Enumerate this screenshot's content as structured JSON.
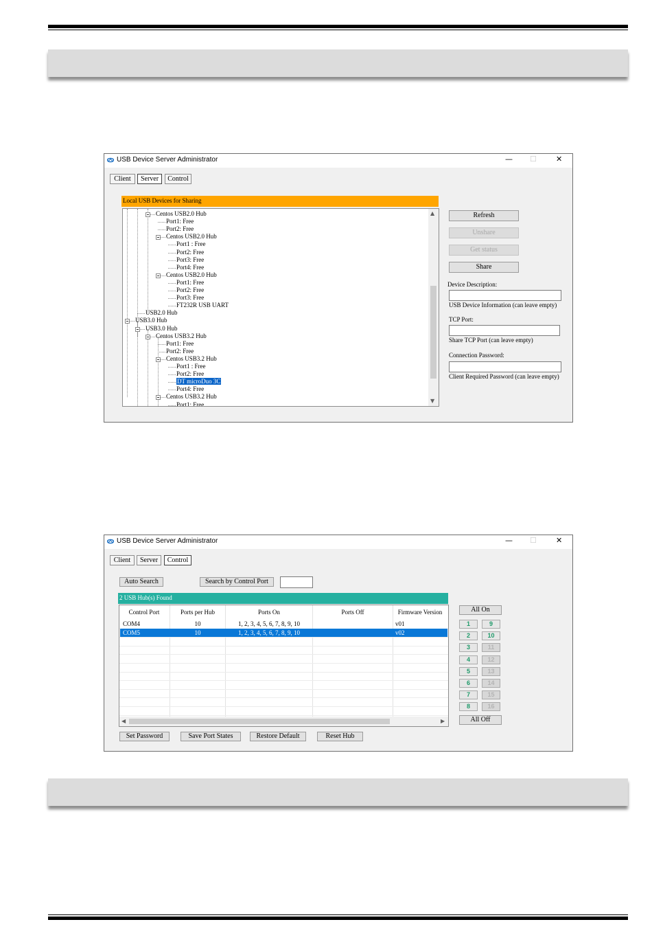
{
  "window1": {
    "title": "USB Device Server Administrator",
    "controls": {
      "minimize": "—",
      "maximize": "☐",
      "close": "✕"
    },
    "tabs": [
      "Client",
      "Server",
      "Control"
    ],
    "active_tab": "Server",
    "panel_header": "Local USB Devices for Sharing",
    "tree": [
      {
        "text": "Centos USB2.0 Hub",
        "level": 3,
        "expander": true
      },
      {
        "text": "Port1: Free",
        "level": 4
      },
      {
        "text": "Port2: Free",
        "level": 4
      },
      {
        "text": "Centos USB2.0 Hub",
        "level": 4,
        "expander": true
      },
      {
        "text": "Port1 : Free",
        "level": 5
      },
      {
        "text": "Port2: Free",
        "level": 5
      },
      {
        "text": "Port3: Free",
        "level": 5
      },
      {
        "text": "Port4: Free",
        "level": 5
      },
      {
        "text": "Centos USB2.0 Hub",
        "level": 4,
        "expander": true
      },
      {
        "text": "Port1: Free",
        "level": 5
      },
      {
        "text": "Port2: Free",
        "level": 5
      },
      {
        "text": "Port3: Free",
        "level": 5
      },
      {
        "text": "FT232R USB UART",
        "level": 5
      },
      {
        "text": "USB2.0 Hub",
        "level": 2
      },
      {
        "text": "USB3.0 Hub",
        "level": 1,
        "expander": true
      },
      {
        "text": "USB3.0 Hub",
        "level": 2,
        "expander": true
      },
      {
        "text": "Centos USB3.2 Hub",
        "level": 3,
        "expander": true
      },
      {
        "text": "Port1: Free",
        "level": 4
      },
      {
        "text": "Port2: Free",
        "level": 4
      },
      {
        "text": "Centos USB3.2 Hub",
        "level": 4,
        "expander": true
      },
      {
        "text": "Port1 : Free",
        "level": 5
      },
      {
        "text": "Port2: Free",
        "level": 5
      },
      {
        "text": "DT microDuo 3C",
        "level": 5,
        "selected": true
      },
      {
        "text": "Port4: Free",
        "level": 5
      },
      {
        "text": "Centos USB3.2 Hub",
        "level": 4,
        "expander": true
      },
      {
        "text": "Port1: Free",
        "level": 5
      }
    ],
    "buttons": {
      "refresh": "Refresh",
      "unshare": "Unshare",
      "get_status": "Get status",
      "share": "Share"
    },
    "device_description": {
      "label": "Device Description:",
      "value": "",
      "hint": "USB Device Information (can leave empty)"
    },
    "tcp_port": {
      "label": "TCP Port:",
      "value": "",
      "hint": "Share TCP Port (can leave empty)"
    },
    "connection_password": {
      "label": "Connection Password:",
      "value": "",
      "hint": "Client Required Password (can leave empty)"
    }
  },
  "window2": {
    "title": "USB Device Server Administrator",
    "controls": {
      "minimize": "—",
      "maximize": "☐",
      "close": "✕"
    },
    "tabs": [
      "Client",
      "Server",
      "Control"
    ],
    "active_tab": "Control",
    "auto_search": "Auto Search",
    "search_by_port": "Search by Control Port",
    "control_port_value": "",
    "found_header": "2 USB Hub(s) Found",
    "columns": [
      "Control Port",
      "Ports per Hub",
      "Ports On",
      "Ports Off",
      "Firmware Version"
    ],
    "rows": [
      {
        "port": "COM4",
        "ports_per_hub": "10",
        "ports_on": "1, 2, 3, 4, 5, 6, 7, 8, 9, 10",
        "ports_off": "",
        "firmware": "v01",
        "selected": false
      },
      {
        "port": "COM5",
        "ports_per_hub": "10",
        "ports_on": "1, 2, 3, 4, 5, 6, 7, 8, 9, 10",
        "ports_off": "",
        "firmware": "v02",
        "selected": true
      }
    ],
    "all_on": "All On",
    "all_off": "All Off",
    "port_buttons": [
      {
        "label": "1",
        "enabled": true
      },
      {
        "label": "9",
        "enabled": true
      },
      {
        "label": "2",
        "enabled": true
      },
      {
        "label": "10",
        "enabled": true
      },
      {
        "label": "3",
        "enabled": true
      },
      {
        "label": "11",
        "enabled": false
      },
      {
        "label": "4",
        "enabled": true
      },
      {
        "label": "12",
        "enabled": false
      },
      {
        "label": "5",
        "enabled": true
      },
      {
        "label": "13",
        "enabled": false
      },
      {
        "label": "6",
        "enabled": true
      },
      {
        "label": "14",
        "enabled": false
      },
      {
        "label": "7",
        "enabled": true
      },
      {
        "label": "15",
        "enabled": false
      },
      {
        "label": "8",
        "enabled": true
      },
      {
        "label": "16",
        "enabled": false
      }
    ],
    "bottom_buttons": [
      "Set Password",
      "Save Port States",
      "Restore Default",
      "Reset Hub"
    ]
  }
}
